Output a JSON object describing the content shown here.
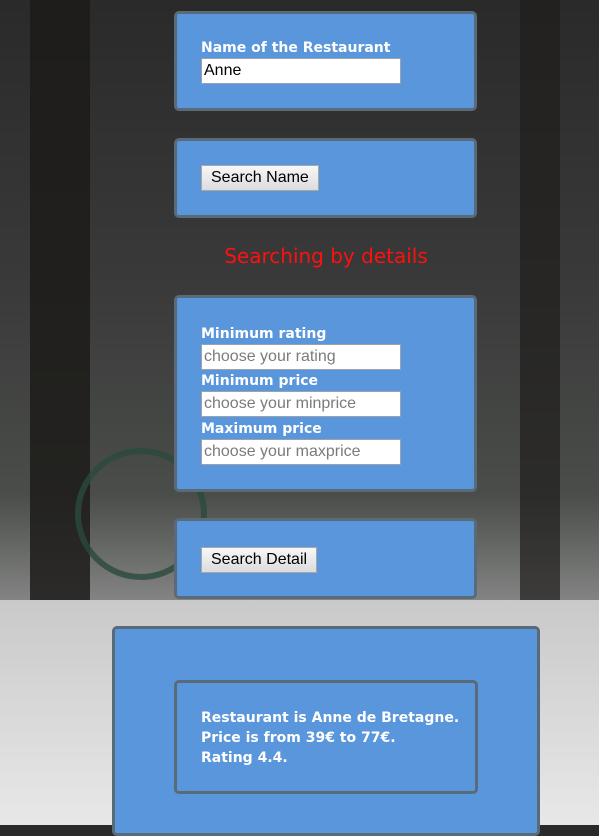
{
  "name_search": {
    "label": "Name of the Restaurant",
    "value": "Anne",
    "button_label": "Search Name"
  },
  "details_heading": "Searching by details",
  "details": {
    "rating_label": "Minimum rating",
    "rating_placeholder": "choose your rating",
    "minprice_label": "Minimum price",
    "minprice_placeholder": "choose your minprice",
    "maxprice_label": "Maximum price",
    "maxprice_placeholder": "choose your maxprice",
    "button_label": "Search Detail"
  },
  "result": {
    "line1": "Restaurant is Anne de Bretagne.",
    "line2": "Price is from 39€ to 77€.",
    "line3": "Rating 4.4."
  },
  "colors": {
    "card": "#5a96db",
    "card_border": "#596a78",
    "heading": "#ff1010"
  }
}
